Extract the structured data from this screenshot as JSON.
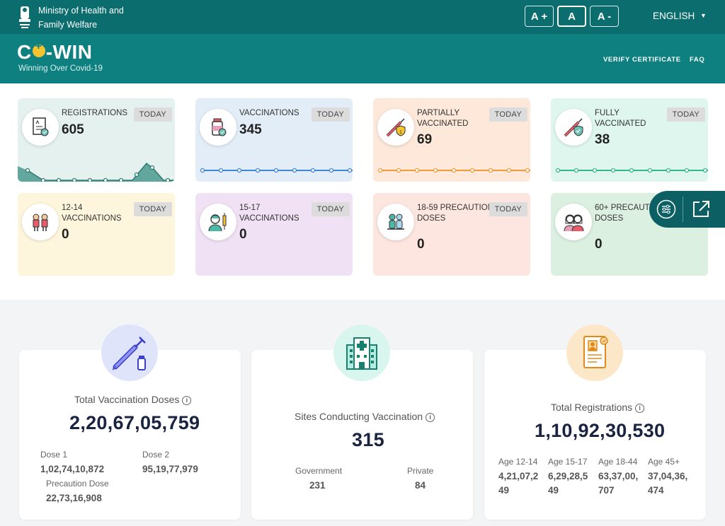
{
  "header": {
    "ministry_line1": "Ministry of Health and",
    "ministry_line2": "Family Welfare",
    "font_increase": "A +",
    "font_normal": "A",
    "font_decrease": "A -",
    "language": "ENGLISH"
  },
  "brand": {
    "logo_part1": "C",
    "logo_part2": "-WIN",
    "tagline": "Winning Over Covid-19",
    "nav_verify": "VERIFY CERTIFICATE",
    "nav_faq": "FAQ"
  },
  "stat_cards": [
    {
      "label": "REGISTRATIONS",
      "value": "605",
      "badge": "TODAY",
      "bg": "#e4f1ef",
      "accent": "#3f9a8c",
      "icon": "registration-document-icon"
    },
    {
      "label": "VACCINATIONS",
      "value": "345",
      "badge": "TODAY",
      "bg": "#e3edf8",
      "accent": "#3f86d6",
      "icon": "vaccine-vial-icon"
    },
    {
      "label": "PARTIALLY VACCINATED",
      "value": "69",
      "badge": "TODAY",
      "bg": "#fde8d9",
      "accent": "#f39a3a",
      "icon": "syringe-shield-partial-icon"
    },
    {
      "label": "FULLY VACCINATED",
      "value": "38",
      "badge": "TODAY",
      "bg": "#dff6ef",
      "accent": "#35b889",
      "icon": "syringe-shield-full-icon"
    },
    {
      "label": "12-14 VACCINATIONS",
      "value": "0",
      "badge": "TODAY",
      "bg": "#fdf6dc",
      "icon": "children-icon"
    },
    {
      "label": "15-17 VACCINATIONS",
      "value": "0",
      "badge": "TODAY",
      "bg": "#f0e1f4",
      "icon": "teen-vaccine-icon"
    },
    {
      "label": "18-59 PRECAUTION DOSES",
      "value": "0",
      "badge": "TODAY",
      "bg": "#fde6e0",
      "icon": "adults-icon"
    },
    {
      "label": "60+ PRECAUTION DOSES",
      "value": "0",
      "badge": "",
      "bg": "#dcf0e2",
      "icon": "elderly-icon"
    }
  ],
  "summary": {
    "doses": {
      "title": "Total Vaccination Doses",
      "total": "2,20,67,05,759",
      "dose1_label": "Dose 1",
      "dose1_value": "1,02,74,10,872",
      "dose2_label": "Dose 2",
      "dose2_value": "95,19,77,979",
      "precaution_label": "Precaution Dose",
      "precaution_value": "22,73,16,908"
    },
    "sites": {
      "title": "Sites Conducting Vaccination",
      "total": "315",
      "gov_label": "Government",
      "gov_value": "231",
      "pvt_label": "Private",
      "pvt_value": "84"
    },
    "registrations": {
      "title": "Total Registrations",
      "total": "1,10,92,30,530",
      "ages": [
        {
          "label": "Age 12-14",
          "value_l1": "4,21,07,2",
          "value_l2": "49"
        },
        {
          "label": "Age 15-17",
          "value_l1": "6,29,28,5",
          "value_l2": "49"
        },
        {
          "label": "Age 18-44",
          "value_l1": "63,37,00,",
          "value_l2": "707"
        },
        {
          "label": "Age 45+",
          "value_l1": "37,04,36,",
          "value_l2": "474"
        }
      ]
    }
  },
  "colors": {
    "topbar": "#0c6d6f",
    "brandbar": "#0f8080",
    "number_dark": "#1a2442"
  }
}
